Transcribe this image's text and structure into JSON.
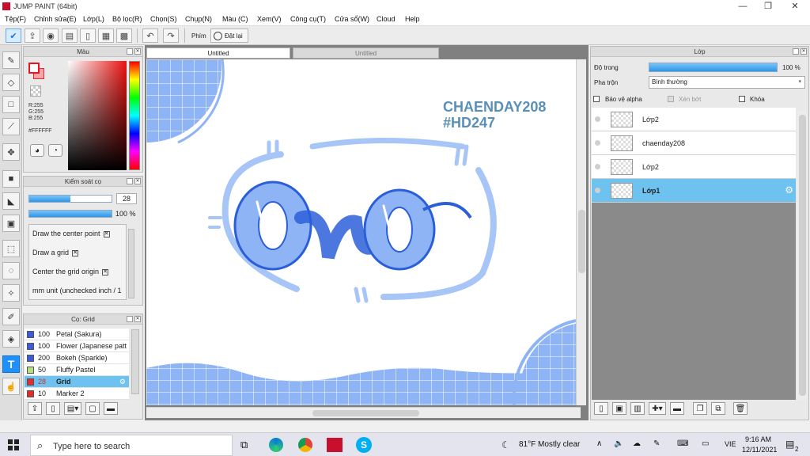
{
  "window": {
    "title": "JUMP PAINT (64bit)",
    "controls": [
      "—",
      "❐",
      "✕"
    ]
  },
  "menu": [
    "Tệp(F)",
    "Chỉnh sửa(E)",
    "Lớp(L)",
    "Bộ lọc(R)",
    "Chọn(S)",
    "Chụp(N)",
    "Màu (C)",
    "Xem(V)",
    "Công cụ(T)",
    "Cửa sổ(W)",
    "Cloud",
    "Help"
  ],
  "toolbar": {
    "keys_label": "Phím",
    "reset_label": "Đặt lại"
  },
  "color_panel": {
    "title": "Màu",
    "rgb": [
      "R:255",
      "G:255",
      "B:255"
    ],
    "hex": "#FFFFFF"
  },
  "brush_control": {
    "title": "Kiểm soát cọ",
    "size": "28",
    "opacity": "100 %",
    "size_fraction": 0.5,
    "opacity_fraction": 1.0,
    "options": [
      "Draw the center point",
      "Draw a grid",
      "Center the grid origin",
      "mm unit (unchecked inch / 1"
    ]
  },
  "brush_list": {
    "title": "Cọ: Grid",
    "items": [
      {
        "size": "100",
        "name": "Petal (Sakura)",
        "color": "#3b5bdb"
      },
      {
        "size": "100",
        "name": "Flower (Japanese patt",
        "color": "#3b5bdb"
      },
      {
        "size": "200",
        "name": "Bokeh (Sparkle)",
        "color": "#3b5bdb"
      },
      {
        "size": "50",
        "name": "Fluffy Pastel",
        "color": "#b6e07a"
      },
      {
        "size": "28",
        "name": "Grid",
        "color": "#e22b2b"
      },
      {
        "size": "10",
        "name": "Marker 2",
        "color": "#e22b2b"
      }
    ]
  },
  "doc_tabs": [
    "Untitled",
    "Untitled"
  ],
  "artwork": {
    "credit_line1": "CHAENDAY208",
    "credit_line2": "#HD247",
    "lettering": "owo"
  },
  "layers_panel": {
    "title": "Lớp",
    "opacity_label": "Độ trong",
    "opacity_value": "100 %",
    "blend_label": "Pha trộn",
    "blend_value": "Bình thường",
    "protect_alpha": "Bảo vệ alpha",
    "clip": "Xén bớt",
    "lock": "Khóa",
    "layers": [
      "Lớp2",
      "chaenday208",
      "Lớp2",
      "Lớp1"
    ]
  },
  "taskbar": {
    "search_placeholder": "Type here to search",
    "weather": "81°F  Mostly clear",
    "lang": "VIE",
    "time": "9:16 AM",
    "date": "12/11/2021",
    "notify_count": "2"
  },
  "colors": {
    "accent": "#1e90ff",
    "selection": "#6ec2f0",
    "art_blue": "#8fb4f5",
    "art_dark": "#2b5fd9"
  }
}
